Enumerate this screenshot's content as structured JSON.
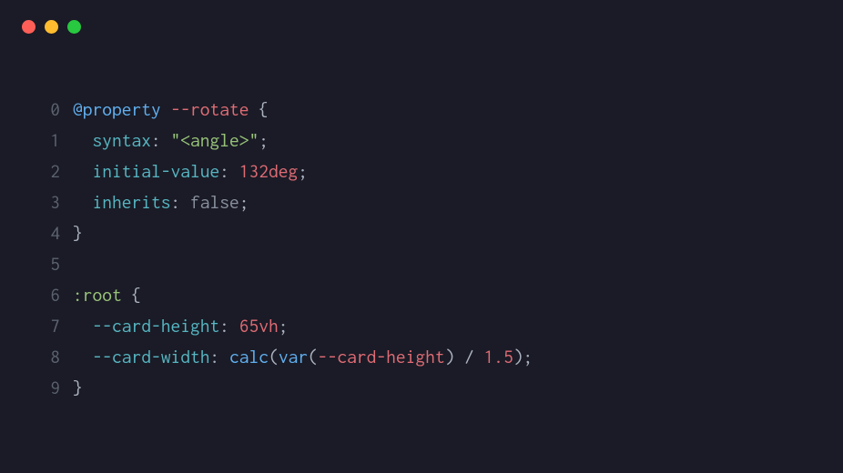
{
  "titleBar": {
    "buttons": [
      "close",
      "minimize",
      "maximize"
    ]
  },
  "code": {
    "lines": [
      {
        "number": "0",
        "tokens": [
          {
            "text": "@property",
            "class": "tok-atrule"
          },
          {
            "text": " ",
            "class": "tok-punct"
          },
          {
            "text": "--rotate",
            "class": "tok-varname"
          },
          {
            "text": " {",
            "class": "tok-punct"
          }
        ]
      },
      {
        "number": "1",
        "tokens": [
          {
            "text": "  ",
            "class": "tok-punct"
          },
          {
            "text": "syntax",
            "class": "tok-property"
          },
          {
            "text": ": ",
            "class": "tok-punct"
          },
          {
            "text": "\"<angle>\"",
            "class": "tok-string"
          },
          {
            "text": ";",
            "class": "tok-punct"
          }
        ]
      },
      {
        "number": "2",
        "tokens": [
          {
            "text": "  ",
            "class": "tok-punct"
          },
          {
            "text": "initial-value",
            "class": "tok-property"
          },
          {
            "text": ": ",
            "class": "tok-punct"
          },
          {
            "text": "132deg",
            "class": "tok-varname"
          },
          {
            "text": ";",
            "class": "tok-punct"
          }
        ]
      },
      {
        "number": "3",
        "tokens": [
          {
            "text": "  ",
            "class": "tok-punct"
          },
          {
            "text": "inherits",
            "class": "tok-property"
          },
          {
            "text": ": ",
            "class": "tok-punct"
          },
          {
            "text": "false",
            "class": "tok-grey"
          },
          {
            "text": ";",
            "class": "tok-punct"
          }
        ]
      },
      {
        "number": "4",
        "tokens": [
          {
            "text": "}",
            "class": "tok-punct"
          }
        ]
      },
      {
        "number": "5",
        "tokens": [
          {
            "text": "",
            "class": "tok-punct"
          }
        ]
      },
      {
        "number": "6",
        "tokens": [
          {
            "text": ":root",
            "class": "tok-pseudo"
          },
          {
            "text": " {",
            "class": "tok-punct"
          }
        ]
      },
      {
        "number": "7",
        "tokens": [
          {
            "text": "  ",
            "class": "tok-punct"
          },
          {
            "text": "--card-height",
            "class": "tok-property"
          },
          {
            "text": ": ",
            "class": "tok-punct"
          },
          {
            "text": "65vh",
            "class": "tok-varname"
          },
          {
            "text": ";",
            "class": "tok-punct"
          }
        ]
      },
      {
        "number": "8",
        "tokens": [
          {
            "text": "  ",
            "class": "tok-punct"
          },
          {
            "text": "--card-width",
            "class": "tok-property"
          },
          {
            "text": ": ",
            "class": "tok-punct"
          },
          {
            "text": "calc",
            "class": "tok-func"
          },
          {
            "text": "(",
            "class": "tok-punct"
          },
          {
            "text": "var",
            "class": "tok-func"
          },
          {
            "text": "(",
            "class": "tok-punct"
          },
          {
            "text": "--card-height",
            "class": "tok-varname"
          },
          {
            "text": ") / ",
            "class": "tok-punct"
          },
          {
            "text": "1.5",
            "class": "tok-varname"
          },
          {
            "text": ");",
            "class": "tok-punct"
          }
        ]
      },
      {
        "number": "9",
        "tokens": [
          {
            "text": "}",
            "class": "tok-punct"
          }
        ]
      }
    ]
  }
}
